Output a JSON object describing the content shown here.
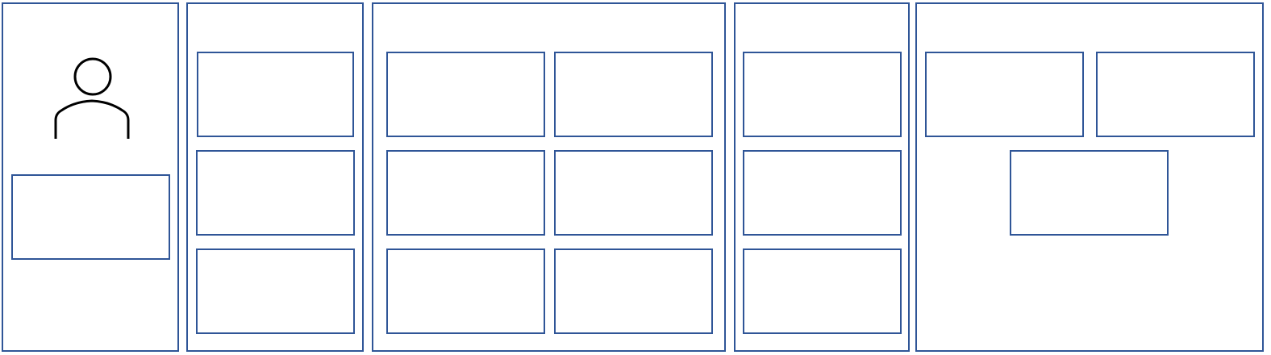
{
  "diagram": {
    "stroke_color": "#2f5597",
    "icon_color": "#000000",
    "background": "#ffffff",
    "icons": {
      "user": "user-icon"
    },
    "columns": [
      {
        "name": "user-column",
        "card_count": 1,
        "has_user_icon": true
      },
      {
        "name": "column-2",
        "card_count": 3
      },
      {
        "name": "column-3",
        "card_count": 6
      },
      {
        "name": "column-4",
        "card_count": 3
      },
      {
        "name": "column-5",
        "card_count": 3
      }
    ]
  }
}
